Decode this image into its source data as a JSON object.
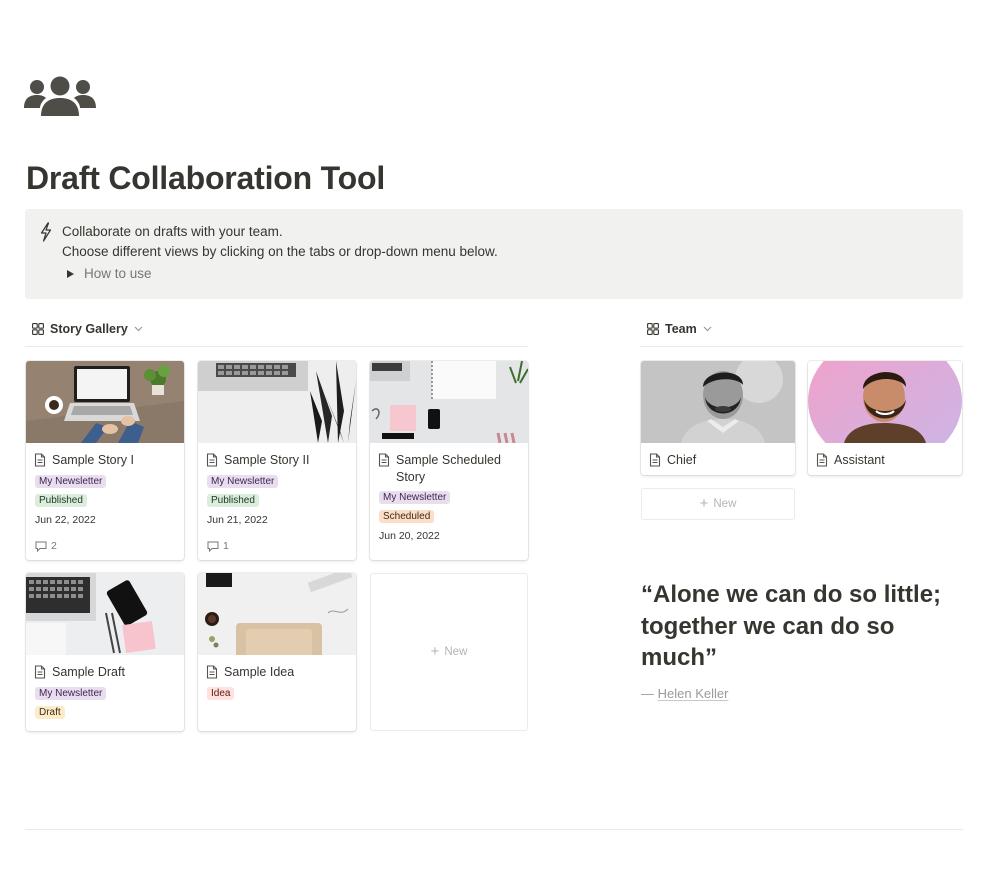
{
  "page": {
    "title": "Draft Collaboration Tool",
    "icon": "team-people-icon"
  },
  "callout": {
    "icon": "lightning-bolt-icon",
    "line1": "Collaborate on drafts with your team.",
    "line2": "Choose different views by clicking on the tabs or drop-down menu below.",
    "toggle_label": "How to use"
  },
  "story_gallery": {
    "view_label": "Story Gallery",
    "view_icon": "gallery-grid-icon",
    "cards": [
      {
        "title": "Sample Story I",
        "tags": [
          {
            "label": "My Newsletter",
            "color": "purple"
          },
          {
            "label": "Published",
            "color": "green"
          }
        ],
        "date": "Jun 22, 2022",
        "comments": "2"
      },
      {
        "title": "Sample Story II",
        "tags": [
          {
            "label": "My Newsletter",
            "color": "purple"
          },
          {
            "label": "Published",
            "color": "green"
          }
        ],
        "date": "Jun 21, 2022",
        "comments": "1"
      },
      {
        "title": "Sample Scheduled Story",
        "tags": [
          {
            "label": "My Newsletter",
            "color": "purple"
          },
          {
            "label": "Scheduled",
            "color": "orange"
          }
        ],
        "date": "Jun 20, 2022"
      },
      {
        "title": "Sample Draft",
        "tags": [
          {
            "label": "My Newsletter",
            "color": "purple"
          },
          {
            "label": "Draft",
            "color": "yellow"
          }
        ]
      },
      {
        "title": "Sample Idea",
        "tags": [
          {
            "label": "Idea",
            "color": "red"
          }
        ]
      }
    ],
    "new_label": "New"
  },
  "team": {
    "view_label": "Team",
    "view_icon": "gallery-grid-icon",
    "cards": [
      {
        "title": "Chief"
      },
      {
        "title": "Assistant"
      }
    ],
    "new_label": "New"
  },
  "quote": {
    "text": "“Alone we can do so little; together we can do so much”",
    "dash": "— ",
    "author": "Helen Keller"
  },
  "colors": {
    "text": "#37352f",
    "muted": "#787774",
    "callout_bg": "#f1f1ef",
    "tag_purple": "#e8deee",
    "tag_green": "#dbeddb",
    "tag_orange": "#fadec9",
    "tag_yellow": "#fdecc8",
    "tag_red": "#ffe2dd"
  }
}
